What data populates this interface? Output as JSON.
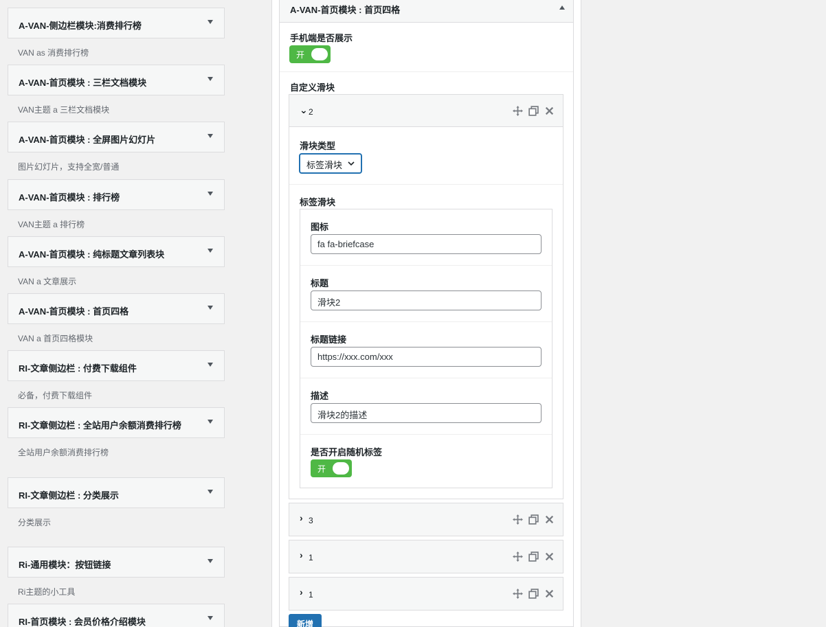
{
  "widgets": [
    {
      "title": "A-VAN-侧边栏模块:消费排行榜",
      "desc": "VAN as 消费排行榜"
    },
    {
      "title": "A-VAN-首页模块 : 三栏文档模块",
      "desc": "VAN主题 a 三栏文档模块"
    },
    {
      "title": "A-VAN-首页模块 : 全屏图片幻灯片",
      "desc": "图片幻灯片，支持全宽/普通"
    },
    {
      "title": "A-VAN-首页模块 : 排行榜",
      "desc": "VAN主题 a 排行榜"
    },
    {
      "title": "A-VAN-首页模块 : 纯标题文章列表块",
      "desc": "VAN a 文章展示"
    },
    {
      "title": "A-VAN-首页模块 : 首页四格",
      "desc": "VAN a 首页四格模块"
    },
    {
      "title": "RI-文章侧边栏 : 付费下载组件",
      "desc": "必备，付费下载组件"
    },
    {
      "title": "RI-文章侧边栏 : 全站用户余额消费排行榜",
      "desc": "全站用户余额消费排行榜"
    },
    {
      "title": "RI-文章侧边栏 : 分类展示",
      "desc": "分类展示"
    },
    {
      "title": "Ri-通用模块：按钮链接",
      "desc": "Ri主题的小工具"
    },
    {
      "title": "RI-首页模块 : 会员价格介绍模块",
      "desc": ""
    }
  ],
  "panel": {
    "title": "A-VAN-首页模块 : 首页四格",
    "mobile_label": "手机端是否展示",
    "mobile_switch": "开",
    "slider_label": "自定义滑块",
    "add_button": "新增",
    "expanded": {
      "title": "2",
      "type_label": "滑块类型",
      "type_value": "标签滑块",
      "section_label": "标签滑块",
      "fields": [
        {
          "label": "图标",
          "value": "fa fa-briefcase"
        },
        {
          "label": "标题",
          "value": "滑块2"
        },
        {
          "label": "标题链接",
          "value": "https://xxx.com/xxx"
        },
        {
          "label": "描述",
          "value": "滑块2的描述"
        }
      ],
      "random_label": "是否开启随机标签",
      "random_switch": "开"
    },
    "collapsed": [
      {
        "title": "3"
      },
      {
        "title": "1"
      },
      {
        "title": "1"
      }
    ]
  },
  "colors": {
    "accent": "#2271b1",
    "switch_on": "#4fb845"
  },
  "icons": [
    "chevron-down-icon",
    "chevron-right-icon",
    "move-icon",
    "clone-icon",
    "close-icon",
    "caret-up-icon"
  ]
}
